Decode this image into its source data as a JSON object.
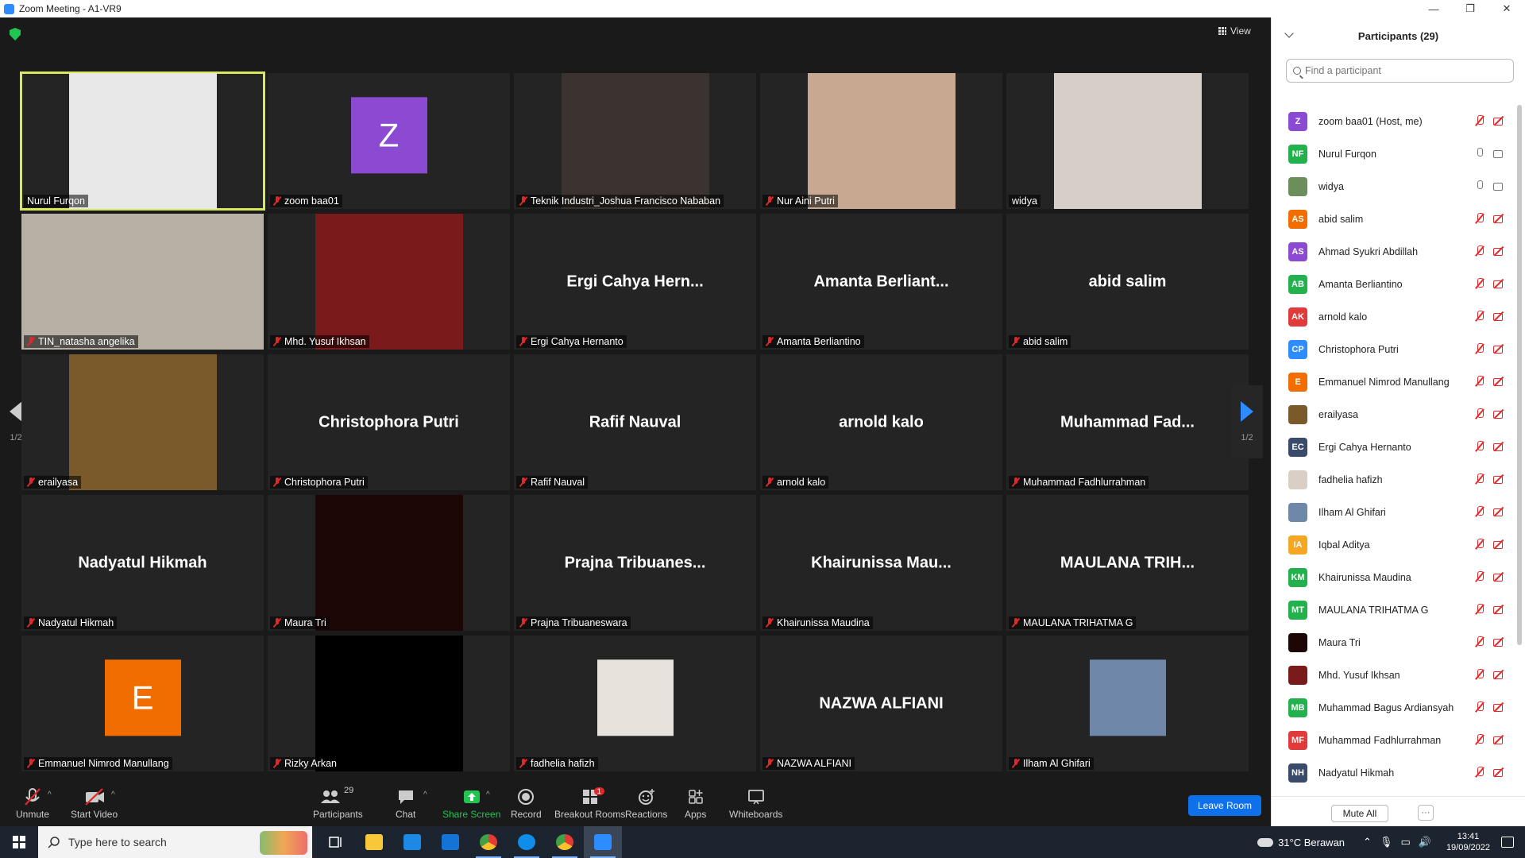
{
  "window": {
    "title": "Zoom Meeting - A1-VR9",
    "minimize": "—",
    "maximize": "❐",
    "close": "✕"
  },
  "meeting": {
    "view_label": "View",
    "page_indicator": "1/2",
    "page_indicator_right": "1/2",
    "tiles": [
      {
        "label": "Nurul Furqon",
        "muted": false,
        "type": "video",
        "active": true,
        "bg": "#e8e8e8"
      },
      {
        "label": "zoom baa01",
        "muted": true,
        "type": "avatar",
        "initial": "Z",
        "color": "#8b4ad1"
      },
      {
        "label": "Teknik Industri_Joshua Francisco Nababan",
        "muted": true,
        "type": "video",
        "bg": "#3a3330"
      },
      {
        "label": "Nur Aini Putri",
        "muted": true,
        "type": "video",
        "bg": "#c9a892"
      },
      {
        "label": "widya",
        "muted": false,
        "type": "video",
        "bg": "#d6cfc9"
      },
      {
        "label": "TIN_natasha angelika",
        "muted": true,
        "type": "video-full",
        "bg": "#b7b0a5"
      },
      {
        "label": "Mhd. Yusuf Ikhsan",
        "muted": true,
        "type": "video",
        "bg": "#7a1a1a"
      },
      {
        "label": "Ergi Cahya Hernanto",
        "muted": true,
        "type": "name",
        "display": "Ergi Cahya Hern..."
      },
      {
        "label": "Amanta Berliantino",
        "muted": true,
        "type": "name",
        "display": "Amanta  Berliant..."
      },
      {
        "label": "abid salim",
        "muted": true,
        "type": "name",
        "display": "abid salim"
      },
      {
        "label": "erailyasa",
        "muted": true,
        "type": "video",
        "bg": "#7a5a2a"
      },
      {
        "label": "Christophora Putri",
        "muted": true,
        "type": "name",
        "display": "Christophora Putri"
      },
      {
        "label": "Rafif Nauval",
        "muted": true,
        "type": "name",
        "display": "Rafif Nauval"
      },
      {
        "label": "arnold kalo",
        "muted": true,
        "type": "name",
        "display": "arnold kalo"
      },
      {
        "label": "Muhammad Fadhlurrahman",
        "muted": true,
        "type": "name",
        "display": "Muhammad  Fad..."
      },
      {
        "label": "Nadyatul Hikmah",
        "muted": true,
        "type": "name",
        "display": "Nadyatul Hikmah"
      },
      {
        "label": "Maura Tri",
        "muted": true,
        "type": "video",
        "bg": "#1c0606"
      },
      {
        "label": "Prajna Tribuaneswara",
        "muted": true,
        "type": "name",
        "display": "Prajna  Tribuanes..."
      },
      {
        "label": "Khairunissa Maudina",
        "muted": true,
        "type": "name",
        "display": "Khairunissa  Mau..."
      },
      {
        "label": "MAULANA TRIHATMA G",
        "muted": true,
        "type": "name",
        "display": "MAULANA  TRIH..."
      },
      {
        "label": "Emmanuel Nimrod Manullang",
        "muted": true,
        "type": "avatar",
        "initial": "E",
        "color": "#f26d00"
      },
      {
        "label": "Rizky Arkan",
        "muted": true,
        "type": "video",
        "bg": "#000000"
      },
      {
        "label": "fadhelia hafizh",
        "muted": true,
        "type": "image",
        "bg": "#e7e2dc"
      },
      {
        "label": "NAZWA ALFIANI",
        "muted": true,
        "type": "name",
        "display": "NAZWA ALFIANI"
      },
      {
        "label": "Ilham Al Ghifari",
        "muted": true,
        "type": "image",
        "bg": "#6f87a8"
      }
    ]
  },
  "toolbar": {
    "unmute": "Unmute",
    "start_video": "Start Video",
    "participants": "Participants",
    "participants_count": "29",
    "chat": "Chat",
    "share_screen": "Share Screen",
    "record": "Record",
    "breakout_rooms": "Breakout Rooms",
    "breakout_badge": "1",
    "reactions": "Reactions",
    "apps": "Apps",
    "whiteboards": "Whiteboards",
    "leave": "Leave Room"
  },
  "panel": {
    "title": "Participants (29)",
    "search_placeholder": "Find a participant",
    "mute_all": "Mute All",
    "more": "···",
    "participants": [
      {
        "name": "zoom baa01 (Host, me)",
        "initials": "Z",
        "color": "#8b4ad1",
        "mic": "off",
        "video": "off"
      },
      {
        "name": "Nurul Furqon",
        "initials": "NF",
        "color": "#23b14d",
        "mic": "on",
        "video": "on"
      },
      {
        "name": "widya",
        "initials": "",
        "color": "#6b8e5a",
        "mic": "on",
        "video": "on"
      },
      {
        "name": "abid salim",
        "initials": "AS",
        "color": "#f26d00",
        "mic": "off",
        "video": "off"
      },
      {
        "name": "Ahmad Syukri Abdillah",
        "initials": "AS",
        "color": "#8b4ad1",
        "mic": "off",
        "video": "off"
      },
      {
        "name": "Amanta Berliantino",
        "initials": "AB",
        "color": "#23b14d",
        "mic": "off",
        "video": "off"
      },
      {
        "name": "arnold kalo",
        "initials": "AK",
        "color": "#e03a3a",
        "mic": "off",
        "video": "off"
      },
      {
        "name": "Christophora Putri",
        "initials": "CP",
        "color": "#2d8cff",
        "mic": "off",
        "video": "off"
      },
      {
        "name": "Emmanuel Nimrod Manullang",
        "initials": "E",
        "color": "#f26d00",
        "mic": "off",
        "video": "off"
      },
      {
        "name": "erailyasa",
        "initials": "",
        "color": "#7a5a2a",
        "mic": "off",
        "video": "off"
      },
      {
        "name": "Ergi Cahya Hernanto",
        "initials": "EC",
        "color": "#3a4a6a",
        "mic": "off",
        "video": "off"
      },
      {
        "name": "fadhelia hafizh",
        "initials": "",
        "color": "#d9cfc4",
        "mic": "off",
        "video": "off"
      },
      {
        "name": "Ilham Al Ghifari",
        "initials": "",
        "color": "#6f87a8",
        "mic": "off",
        "video": "off"
      },
      {
        "name": "Iqbal Aditya",
        "initials": "IA",
        "color": "#f5a623",
        "mic": "off",
        "video": "off"
      },
      {
        "name": "Khairunissa Maudina",
        "initials": "KM",
        "color": "#23b14d",
        "mic": "off",
        "video": "off"
      },
      {
        "name": "MAULANA TRIHATMA G",
        "initials": "MT",
        "color": "#23b14d",
        "mic": "off",
        "video": "off"
      },
      {
        "name": "Maura Tri",
        "initials": "",
        "color": "#1c0606",
        "mic": "off",
        "video": "off"
      },
      {
        "name": "Mhd. Yusuf Ikhsan",
        "initials": "",
        "color": "#7a1a1a",
        "mic": "off",
        "video": "off"
      },
      {
        "name": "Muhammad Bagus Ardiansyah",
        "initials": "MB",
        "color": "#23b14d",
        "mic": "off",
        "video": "off"
      },
      {
        "name": "Muhammad Fadhlurrahman",
        "initials": "MF",
        "color": "#e03a3a",
        "mic": "off",
        "video": "off"
      },
      {
        "name": "Nadyatul Hikmah",
        "initials": "NH",
        "color": "#3a4a6a",
        "mic": "off",
        "video": "off"
      }
    ]
  },
  "taskbar": {
    "search_placeholder": "Type here to search",
    "weather": "31°C  Berawan",
    "time": "13:41",
    "date": "19/09/2022"
  }
}
